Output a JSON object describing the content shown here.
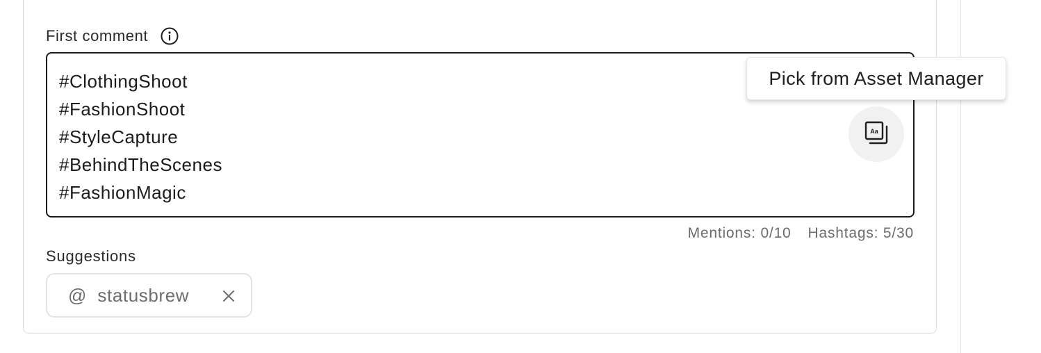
{
  "first_comment": {
    "label": "First comment",
    "lines": [
      "#ClothingShoot",
      "#FashionShoot",
      "#StyleCapture",
      "#BehindTheScenes",
      "#FashionMagic"
    ],
    "info_icon": "info-circle-icon",
    "asset_button_icon": "asset-library-icon"
  },
  "tooltip": {
    "text": "Pick from Asset Manager"
  },
  "counters": {
    "mentions": "Mentions: 0/10",
    "hashtags": "Hashtags: 5/30"
  },
  "suggestions": {
    "label": "Suggestions",
    "chips": [
      {
        "prefix": "@",
        "name": "statusbrew",
        "close_icon": "close-icon"
      }
    ]
  },
  "colors": {
    "text": "#1f1f1f",
    "muted": "#6b6b6b",
    "border": "#dcdcdc",
    "editor_border": "#1a1a1a",
    "button_bg": "#f1f1f1"
  }
}
